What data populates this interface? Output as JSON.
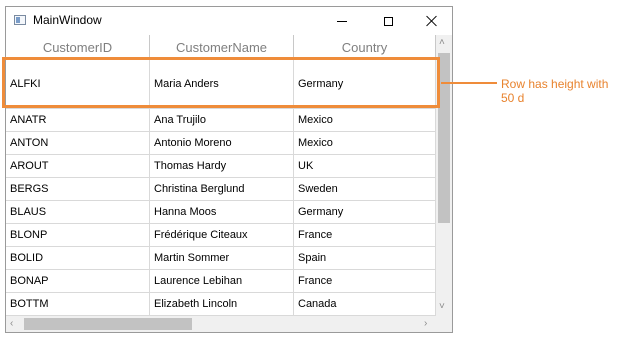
{
  "window": {
    "title": "MainWindow"
  },
  "grid": {
    "columns": [
      "CustomerID",
      "CustomerName",
      "Country"
    ],
    "rows": [
      {
        "id": "ALFKI",
        "name": "Maria Anders",
        "country": "Germany"
      },
      {
        "id": "ANATR",
        "name": "Ana Trujilo",
        "country": "Mexico"
      },
      {
        "id": "ANTON",
        "name": "Antonio Moreno",
        "country": "Mexico"
      },
      {
        "id": "AROUT",
        "name": "Thomas Hardy",
        "country": "UK"
      },
      {
        "id": "BERGS",
        "name": "Christina Berglund",
        "country": "Sweden"
      },
      {
        "id": "BLAUS",
        "name": "Hanna Moos",
        "country": "Germany"
      },
      {
        "id": "BLONP",
        "name": "Frédérique Citeaux",
        "country": "France"
      },
      {
        "id": "BOLID",
        "name": "Martin Sommer",
        "country": "Spain"
      },
      {
        "id": "BONAP",
        "name": "Laurence Lebihan",
        "country": "France"
      },
      {
        "id": "BOTTM",
        "name": "Elizabeth Lincoln",
        "country": "Canada"
      }
    ]
  },
  "annotation": {
    "text": "Row has height with 50 d",
    "color": "#ef8c3a"
  }
}
